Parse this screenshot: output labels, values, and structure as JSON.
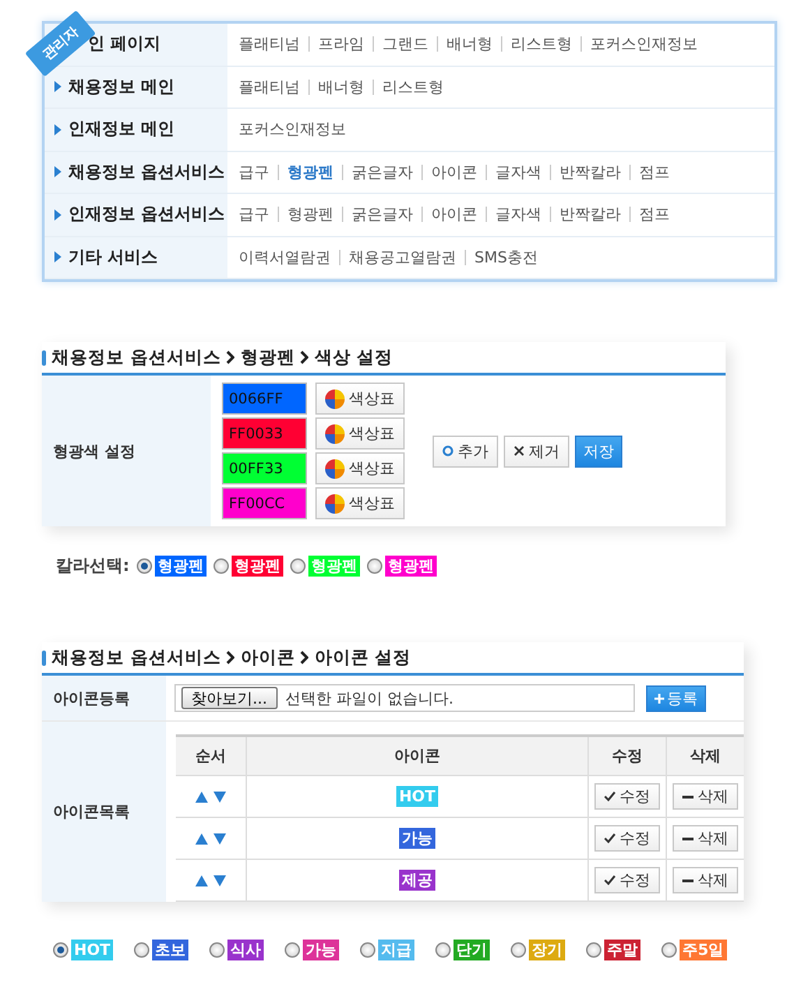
{
  "menu": {
    "badge": "관리자",
    "rows": [
      {
        "label": "인 페이지",
        "arrow": false,
        "links": [
          {
            "text": "플래티넘",
            "selected": false
          },
          {
            "text": "프라임",
            "selected": false
          },
          {
            "text": "그랜드",
            "selected": false
          },
          {
            "text": "배너형",
            "selected": false
          },
          {
            "text": "리스트형",
            "selected": false
          },
          {
            "text": "포커스인재정보",
            "selected": false
          }
        ]
      },
      {
        "label": "채용정보 메인",
        "arrow": true,
        "links": [
          {
            "text": "플래티넘",
            "selected": false
          },
          {
            "text": "배너형",
            "selected": false
          },
          {
            "text": "리스트형",
            "selected": false
          }
        ]
      },
      {
        "label": "인재정보 메인",
        "arrow": true,
        "links": [
          {
            "text": "포커스인재정보",
            "selected": false
          }
        ]
      },
      {
        "label": "채용정보 옵션서비스",
        "arrow": true,
        "links": [
          {
            "text": "급구",
            "selected": false
          },
          {
            "text": "형광펜",
            "selected": true
          },
          {
            "text": "굵은글자",
            "selected": false
          },
          {
            "text": "아이콘",
            "selected": false
          },
          {
            "text": "글자색",
            "selected": false
          },
          {
            "text": "반짝칼라",
            "selected": false
          },
          {
            "text": "점프",
            "selected": false
          }
        ]
      },
      {
        "label": "인재정보 옵션서비스",
        "arrow": true,
        "links": [
          {
            "text": "급구",
            "selected": false
          },
          {
            "text": "형광펜",
            "selected": false
          },
          {
            "text": "굵은글자",
            "selected": false
          },
          {
            "text": "아이콘",
            "selected": false
          },
          {
            "text": "글자색",
            "selected": false
          },
          {
            "text": "반짝칼라",
            "selected": false
          },
          {
            "text": "점프",
            "selected": false
          }
        ]
      },
      {
        "label": "기타 서비스",
        "arrow": true,
        "links": [
          {
            "text": "이력서열람권",
            "selected": false
          },
          {
            "text": "채용공고열람권",
            "selected": false
          },
          {
            "text": "SMS충전",
            "selected": false
          }
        ]
      }
    ]
  },
  "color_settings": {
    "breadcrumb": [
      "채용정보 옵션서비스",
      "형광펜",
      "색상 설정"
    ],
    "row_label": "형광색 설정",
    "colors": [
      {
        "value": "0066FF",
        "color": "#0066ff",
        "palette_button": "색상표"
      },
      {
        "value": "FF0033",
        "color": "#ff0033",
        "palette_button": "색상표"
      },
      {
        "value": "00FF33",
        "color": "#00ff33",
        "palette_button": "색상표"
      },
      {
        "value": "FF00CC",
        "color": "#ff00cc",
        "palette_button": "색상표"
      }
    ],
    "buttons": [
      {
        "kind": "add",
        "label": "추가"
      },
      {
        "kind": "remove",
        "label": "제거"
      },
      {
        "kind": "save",
        "label": "저장"
      }
    ]
  },
  "color_choice": {
    "label": "칼라선택:",
    "options": [
      {
        "text": "형광펜",
        "color": "#0066ff",
        "selected": true
      },
      {
        "text": "형광펜",
        "color": "#ff0033",
        "selected": false
      },
      {
        "text": "형광펜",
        "color": "#00ff33",
        "selected": false
      },
      {
        "text": "형광펜",
        "color": "#ff00cc",
        "selected": false
      }
    ]
  },
  "icon_settings": {
    "breadcrumb": [
      "채용정보 옵션서비스",
      "아이콘",
      "아이콘 설정"
    ],
    "register": {
      "label": "아이콘등록",
      "browse": "찾아보기...",
      "file_status": "선택한 파일이 없습니다.",
      "submit": "등록"
    },
    "list": {
      "label": "아이콘목록",
      "columns": [
        "순서",
        "아이콘",
        "수정",
        "삭제"
      ],
      "rows": [
        {
          "badge": "HOT",
          "color": "#33ccee",
          "edit": "수정",
          "delete": "삭제"
        },
        {
          "badge": "가능",
          "color": "#3366dd",
          "edit": "수정",
          "delete": "삭제"
        },
        {
          "badge": "제공",
          "color": "#9933cc",
          "edit": "수정",
          "delete": "삭제"
        }
      ]
    }
  },
  "icon_choice": [
    {
      "text": "HOT",
      "color": "#33ccee",
      "selected": true
    },
    {
      "text": "초보",
      "color": "#3366dd",
      "selected": false
    },
    {
      "text": "식사",
      "color": "#9933cc",
      "selected": false
    },
    {
      "text": "가능",
      "color": "#dd3399",
      "selected": false
    },
    {
      "text": "지급",
      "color": "#55bbee",
      "selected": false
    },
    {
      "text": "단기",
      "color": "#22aa22",
      "selected": false
    },
    {
      "text": "장기",
      "color": "#ddaa11",
      "selected": false
    },
    {
      "text": "주말",
      "color": "#cc2233",
      "selected": false
    },
    {
      "text": "주5일",
      "color": "#ff7733",
      "selected": false
    }
  ]
}
